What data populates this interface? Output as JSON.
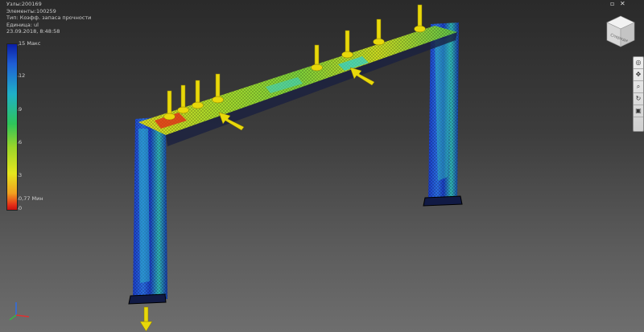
{
  "info": {
    "nodes": "Узлы:200169",
    "elements": "Элементы:100259",
    "type": "Тип: Коэфф. запаса прочности",
    "units": "Единица: ul",
    "datetime": "23.09.2018, 8:48:58"
  },
  "legend": {
    "max_label": "15 Макс",
    "tick_12": "12",
    "tick_9": "9",
    "tick_6": "6",
    "tick_3": "3",
    "min_label": "0,77 Мин",
    "tick_0": "0"
  },
  "viewcube": {
    "face_label": "Спереди"
  },
  "window_buttons": {
    "restore": "▫",
    "close": "✕"
  },
  "navbar": {
    "items": [
      "steering-wheel-icon",
      "pan-icon",
      "zoom-icon",
      "orbit-icon",
      "look-at-icon"
    ]
  },
  "colors": {
    "min": "#c81010",
    "max": "#0a1ea6",
    "load_arrow": "#e8d80a"
  }
}
